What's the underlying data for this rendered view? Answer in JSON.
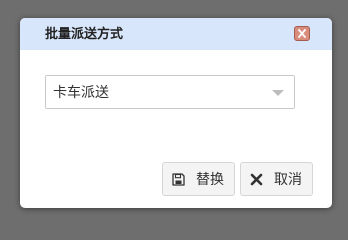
{
  "dialog": {
    "title": "批量派送方式",
    "close_icon": "close-icon"
  },
  "select": {
    "value": "卡车派送",
    "arrow_icon": "chevron-down-icon"
  },
  "buttons": {
    "replace_label": "替换",
    "replace_icon": "save-icon",
    "cancel_label": "取消",
    "cancel_icon": "x-icon"
  },
  "colors": {
    "titlebar": "#d8e6fb",
    "close_button": "#d98c7c",
    "button_background": "#f4f4f4"
  }
}
